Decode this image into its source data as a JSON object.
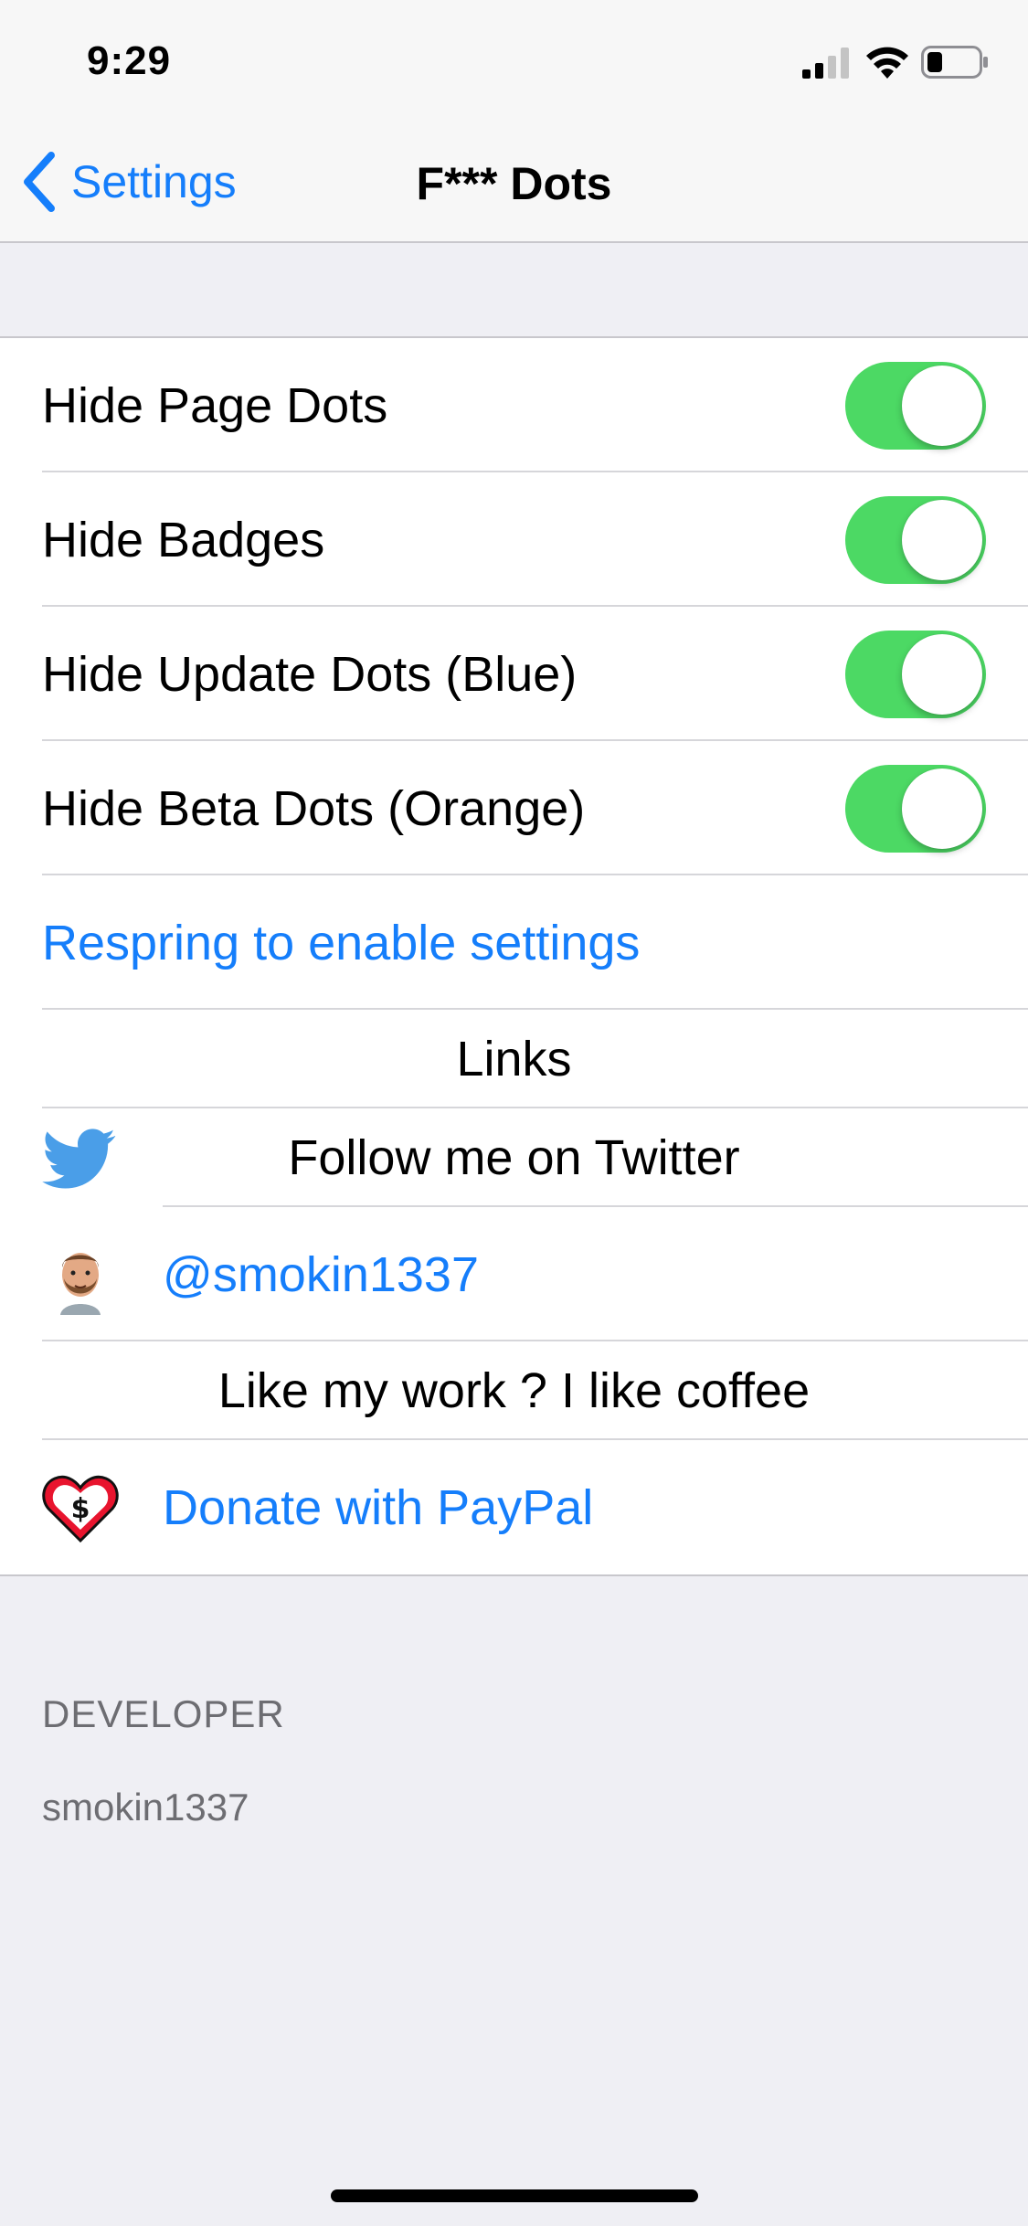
{
  "status_bar": {
    "time": "9:29",
    "icons": [
      "signal-icon",
      "wifi-icon",
      "battery-icon"
    ]
  },
  "nav": {
    "back_label": "Settings",
    "title": "F*** Dots"
  },
  "toggles": [
    {
      "label": "Hide Page Dots",
      "on": true
    },
    {
      "label": "Hide Badges",
      "on": true
    },
    {
      "label": "Hide Update Dots (Blue)",
      "on": true
    },
    {
      "label": "Hide Beta Dots (Orange)",
      "on": true
    }
  ],
  "respring_label": "Respring to enable settings",
  "links": {
    "header": "Links",
    "twitter_label": "Follow me on Twitter",
    "twitter_handle": "@smokin1337",
    "coffee_label": "Like my work ? I like coffee",
    "donate_label": "Donate with PayPal"
  },
  "footer": {
    "header": "DEVELOPER",
    "value": "smokin1337"
  },
  "colors": {
    "accent": "#157EFB",
    "toggle_on": "#4CD964",
    "background": "#EFEFF4"
  }
}
